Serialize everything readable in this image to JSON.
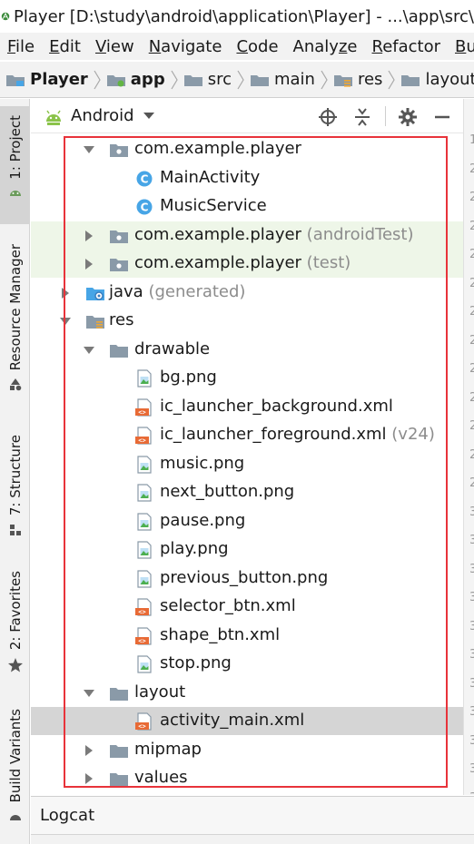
{
  "window": {
    "title": "Player [D:\\study\\android\\application\\Player] - ...\\app\\src\\"
  },
  "menu": [
    {
      "label": "File",
      "mnemonic": "F"
    },
    {
      "label": "Edit",
      "mnemonic": "E"
    },
    {
      "label": "View",
      "mnemonic": "V"
    },
    {
      "label": "Navigate",
      "mnemonic": "N"
    },
    {
      "label": "Code",
      "mnemonic": "C"
    },
    {
      "label": "Analyze",
      "mnemonic": "z"
    },
    {
      "label": "Refactor",
      "mnemonic": "R"
    },
    {
      "label": "Bu",
      "mnemonic": "B"
    }
  ],
  "breadcrumbs": [
    "Player",
    "app",
    "src",
    "main",
    "res",
    "layout"
  ],
  "sidebar": {
    "tabs": [
      {
        "label": "1: Project"
      },
      {
        "label": "Resource Manager"
      },
      {
        "label": "7: Structure"
      },
      {
        "label": "2: Favorites"
      },
      {
        "label": "Build Variants"
      }
    ]
  },
  "panel": {
    "view_mode": "Android"
  },
  "tree": [
    {
      "label": "com.example.player",
      "suffix": "",
      "icon": "package-folder-icon",
      "arrow": "down"
    },
    {
      "label": "MainActivity",
      "suffix": "",
      "icon": "class-icon",
      "arrow": "none"
    },
    {
      "label": "MusicService",
      "suffix": "",
      "icon": "class-icon",
      "arrow": "none"
    },
    {
      "label": "com.example.player",
      "suffix": " (androidTest)",
      "icon": "package-folder-icon",
      "arrow": "right"
    },
    {
      "label": "com.example.player",
      "suffix": " (test)",
      "icon": "package-folder-icon",
      "arrow": "right"
    },
    {
      "label": "java",
      "suffix": " (generated)",
      "icon": "generated-folder-icon",
      "arrow": "right"
    },
    {
      "label": "res",
      "suffix": "",
      "icon": "resource-folder-icon",
      "arrow": "down"
    },
    {
      "label": "drawable",
      "suffix": "",
      "icon": "folder-icon",
      "arrow": "down"
    },
    {
      "label": "bg.png",
      "suffix": "",
      "icon": "image-file-icon",
      "arrow": "none"
    },
    {
      "label": "ic_launcher_background.xml",
      "suffix": "",
      "icon": "xml-file-icon",
      "arrow": "none"
    },
    {
      "label": "ic_launcher_foreground.xml",
      "suffix": " (v24)",
      "icon": "xml-file-icon",
      "arrow": "none"
    },
    {
      "label": "music.png",
      "suffix": "",
      "icon": "image-file-icon",
      "arrow": "none"
    },
    {
      "label": "next_button.png",
      "suffix": "",
      "icon": "image-file-icon",
      "arrow": "none"
    },
    {
      "label": "pause.png",
      "suffix": "",
      "icon": "image-file-icon",
      "arrow": "none"
    },
    {
      "label": "play.png",
      "suffix": "",
      "icon": "image-file-icon",
      "arrow": "none"
    },
    {
      "label": "previous_button.png",
      "suffix": "",
      "icon": "image-file-icon",
      "arrow": "none"
    },
    {
      "label": "selector_btn.xml",
      "suffix": "",
      "icon": "xml-file-icon",
      "arrow": "none"
    },
    {
      "label": "shape_btn.xml",
      "suffix": "",
      "icon": "xml-file-icon",
      "arrow": "none"
    },
    {
      "label": "stop.png",
      "suffix": "",
      "icon": "image-file-icon",
      "arrow": "none"
    },
    {
      "label": "layout",
      "suffix": "",
      "icon": "folder-icon",
      "arrow": "down"
    },
    {
      "label": "activity_main.xml",
      "suffix": "",
      "icon": "xml-file-icon",
      "arrow": "none",
      "selected": true
    },
    {
      "label": "mipmap",
      "suffix": "",
      "icon": "folder-icon",
      "arrow": "right"
    },
    {
      "label": "values",
      "suffix": "",
      "icon": "folder-icon",
      "arrow": "right"
    }
  ],
  "bottom": {
    "logcat_label": "Logcat"
  },
  "colors": {
    "highlight_box": "#e8333a",
    "test_rows_bg": "#eef6e8",
    "selected_row_bg": "#d5d5d5",
    "class_icon": "#47a5e6",
    "xml_icon": "#e86a35",
    "android_green": "#8bc34a"
  }
}
